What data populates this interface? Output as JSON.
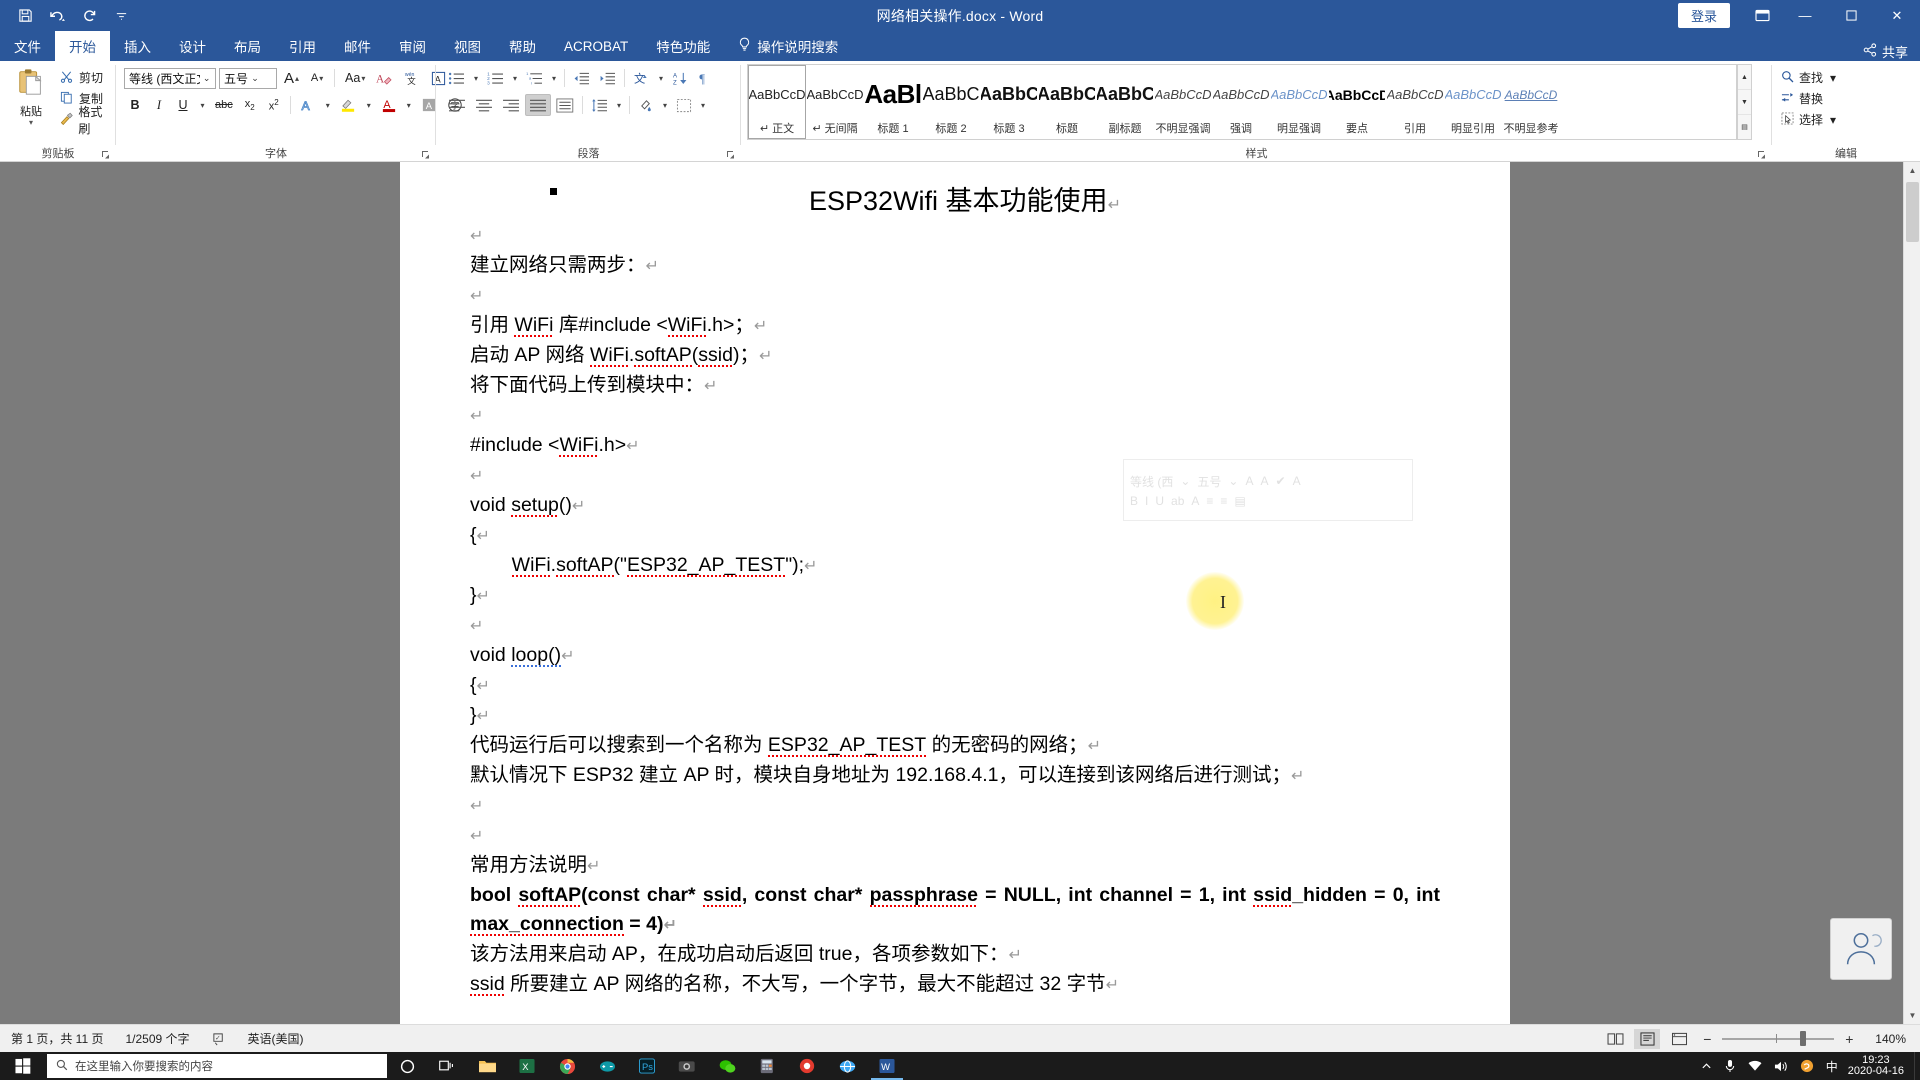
{
  "titlebar": {
    "doc_title": "网络相关操作.docx  -  Word",
    "signin_label": "登录",
    "qat": [
      {
        "name": "save-icon",
        "label": "保存"
      },
      {
        "name": "undo-icon",
        "label": "撤消"
      },
      {
        "name": "redo-icon",
        "label": "恢复"
      },
      {
        "name": "customize-qat-icon",
        "label": "自定义快速访问工具栏"
      }
    ],
    "window_buttons": {
      "minimize": "—",
      "maximize": "☐",
      "close": "✕"
    },
    "ribbon_display_options": "功能区显示选项"
  },
  "tabs": [
    {
      "label": "文件",
      "active": false
    },
    {
      "label": "开始",
      "active": true
    },
    {
      "label": "插入",
      "active": false
    },
    {
      "label": "设计",
      "active": false
    },
    {
      "label": "布局",
      "active": false
    },
    {
      "label": "引用",
      "active": false
    },
    {
      "label": "邮件",
      "active": false
    },
    {
      "label": "审阅",
      "active": false
    },
    {
      "label": "视图",
      "active": false
    },
    {
      "label": "帮助",
      "active": false
    },
    {
      "label": "ACROBAT",
      "active": false
    },
    {
      "label": "特色功能",
      "active": false
    }
  ],
  "tell_me": "操作说明搜索",
  "share_label": "共享",
  "ribbon": {
    "groups": [
      {
        "name": "clipboard",
        "label": "剪贴板"
      },
      {
        "name": "font",
        "label": "字体"
      },
      {
        "name": "paragraph",
        "label": "段落"
      },
      {
        "name": "styles",
        "label": "样式"
      },
      {
        "name": "editing",
        "label": "编辑"
      }
    ],
    "clipboard": {
      "paste_label": "粘贴",
      "items": [
        {
          "label": "剪切",
          "icon": "scissors-icon"
        },
        {
          "label": "复制",
          "icon": "copy-icon"
        },
        {
          "label": "格式刷",
          "icon": "format-painter-icon"
        }
      ]
    },
    "font": {
      "font_name": "等线 (西文正文",
      "font_size": "五号",
      "buttons": [
        {
          "name": "grow-font",
          "label": "A"
        },
        {
          "name": "shrink-font",
          "label": "A"
        },
        {
          "name": "change-case",
          "label": "Aa"
        },
        {
          "name": "clear-formatting",
          "label": "清除所有格式"
        },
        {
          "name": "phonetic-guide",
          "label": "拼音指南"
        },
        {
          "name": "character-border",
          "label": "字符边框"
        },
        {
          "name": "bold",
          "label": "B"
        },
        {
          "name": "italic",
          "label": "I"
        },
        {
          "name": "underline",
          "label": "U"
        },
        {
          "name": "strikethrough",
          "label": "abc"
        },
        {
          "name": "subscript",
          "label": "x₂"
        },
        {
          "name": "superscript",
          "label": "x²"
        },
        {
          "name": "text-effects",
          "label": "A"
        },
        {
          "name": "text-highlight-color",
          "label": "ab"
        },
        {
          "name": "font-color",
          "label": "A"
        },
        {
          "name": "character-shading",
          "label": "A"
        },
        {
          "name": "enclose-characters",
          "label": "字"
        }
      ]
    },
    "paragraph": {
      "buttons": [
        {
          "name": "bullets",
          "label": "项目符号"
        },
        {
          "name": "numbering",
          "label": "编号"
        },
        {
          "name": "multilevel-list",
          "label": "多级列表"
        },
        {
          "name": "decrease-indent",
          "label": "减少缩进量"
        },
        {
          "name": "increase-indent",
          "label": "增加缩进量"
        },
        {
          "name": "asian-layout",
          "label": "中文版式"
        },
        {
          "name": "sort",
          "label": "排序"
        },
        {
          "name": "show-formatting-marks",
          "label": "显示编辑标记"
        },
        {
          "name": "align-left",
          "label": "左对齐"
        },
        {
          "name": "align-center",
          "label": "居中"
        },
        {
          "name": "align-right",
          "label": "右对齐"
        },
        {
          "name": "justify",
          "label": "两端对齐"
        },
        {
          "name": "distributed",
          "label": "分散对齐"
        },
        {
          "name": "line-spacing",
          "label": "行和段落间距"
        },
        {
          "name": "shading",
          "label": "底纹"
        },
        {
          "name": "borders",
          "label": "边框"
        }
      ]
    },
    "styles": {
      "items": [
        {
          "preview": "AaBbCcD",
          "name": "正文",
          "mark": "↵",
          "active": true,
          "style": "normal"
        },
        {
          "preview": "AaBbCcD",
          "name": "无间隔",
          "mark": "↵",
          "active": false,
          "style": "normal"
        },
        {
          "preview": "AaBl",
          "name": "标题 1",
          "mark": "",
          "active": false,
          "style": "h1"
        },
        {
          "preview": "AaBbC",
          "name": "标题 2",
          "mark": "",
          "active": false,
          "style": "h2"
        },
        {
          "preview": "AaBbC",
          "name": "标题 3",
          "mark": "",
          "active": false,
          "style": "h3"
        },
        {
          "preview": "AaBbC",
          "name": "标题",
          "mark": "",
          "active": false,
          "style": "h3"
        },
        {
          "preview": "AaBbC",
          "name": "副标题",
          "mark": "",
          "active": false,
          "style": "h3b"
        },
        {
          "preview": "AaBbCcD",
          "name": "不明显强调",
          "mark": "",
          "active": false,
          "style": "ital"
        },
        {
          "preview": "AaBbCcD",
          "name": "强调",
          "mark": "",
          "active": false,
          "style": "ital"
        },
        {
          "preview": "AaBbCcD",
          "name": "明显强调",
          "mark": "",
          "active": false,
          "style": "italblue"
        },
        {
          "preview": "AaBbCcD",
          "name": "要点",
          "mark": "",
          "active": false,
          "style": "boldn"
        },
        {
          "preview": "AaBbCcD",
          "name": "引用",
          "mark": "",
          "active": false,
          "style": "ital"
        },
        {
          "preview": "AaBbCcD",
          "name": "明显引用",
          "mark": "",
          "active": false,
          "style": "italblue"
        },
        {
          "preview": "AaBbCcD",
          "name": "不明显参考",
          "mark": "",
          "active": false,
          "style": "smallcap"
        }
      ]
    },
    "editing": {
      "items": [
        {
          "label": "查找",
          "icon": "search-icon",
          "caret": true
        },
        {
          "label": "替换",
          "icon": "replace-icon",
          "caret": false
        },
        {
          "label": "选择",
          "icon": "select-icon",
          "caret": true
        }
      ]
    }
  },
  "document": {
    "title": "ESP32Wifi 基本功能使用",
    "paragraphs": [
      {
        "id": "p1",
        "text": "",
        "mark": "↵"
      },
      {
        "id": "p2",
        "text": "建立网络只需两步：",
        "mark": "↵"
      },
      {
        "id": "p3",
        "text": "",
        "mark": "↵"
      },
      {
        "id": "p4",
        "text": "引用 WiFi 库#include <WiFi.h>；",
        "mark": "↵"
      },
      {
        "id": "p5",
        "text": "启动 AP 网络 WiFi.softAP(ssid)；",
        "mark": "↵"
      },
      {
        "id": "p6",
        "text": "将下面代码上传到模块中：",
        "mark": "↵"
      },
      {
        "id": "p7",
        "text": "",
        "mark": "↵"
      },
      {
        "id": "p8",
        "text": "#include <WiFi.h>",
        "mark": "↵"
      },
      {
        "id": "p9",
        "text": "",
        "mark": "↵"
      },
      {
        "id": "p10",
        "text": "void setup()",
        "mark": "↵"
      },
      {
        "id": "p11",
        "text": "{",
        "mark": "↵"
      },
      {
        "id": "p12",
        "text": "    WiFi.softAP(\"ESP32_AP_TEST\");",
        "mark": "↵"
      },
      {
        "id": "p13",
        "text": "}",
        "mark": "↵"
      },
      {
        "id": "p14",
        "text": "",
        "mark": "↵"
      },
      {
        "id": "p15",
        "text": "void loop()",
        "mark": "↵"
      },
      {
        "id": "p16",
        "text": "{",
        "mark": "↵"
      },
      {
        "id": "p17",
        "text": "}",
        "mark": "↵"
      },
      {
        "id": "p18",
        "text": "代码运行后可以搜索到一个名称为 ESP32_AP_TEST 的无密码的网络；",
        "mark": "↵"
      },
      {
        "id": "p19",
        "text": "默认情况下 ESP32 建立 AP 时，模块自身地址为 192.168.4.1，可以连接到该网络后进行测试；",
        "mark": "↵"
      },
      {
        "id": "p20",
        "text": "",
        "mark": "↵"
      },
      {
        "id": "p21",
        "text": "",
        "mark": "↵"
      },
      {
        "id": "p22",
        "text": "常用方法说明",
        "mark": "↵"
      },
      {
        "id": "p23",
        "text": "bool softAP(const char* ssid, const char* passphrase = NULL, int channel = 1, int ssid_hidden = 0, int max_connection = 4)",
        "mark": "↵"
      },
      {
        "id": "p24",
        "text": "该方法用来启动 AP，在成功启动后返回 true，各项参数如下：",
        "mark": "↵"
      },
      {
        "id": "p25",
        "text": "ssid 所要建立 AP 网络的名称，不大写，一个字节，最大不能超过 32 字节",
        "mark": "↵"
      }
    ]
  },
  "statusbar": {
    "page_info": "第 1 页，共 11 页",
    "word_count": "1/2509 个字",
    "proofing_icon": "proofing-errors-icon",
    "language": "英语(美国)",
    "views": [
      {
        "name": "read-mode",
        "label": "阅读视图"
      },
      {
        "name": "print-layout",
        "label": "页面视图",
        "selected": true
      },
      {
        "name": "web-layout",
        "label": "Web 版式视图"
      }
    ],
    "zoom_level": "140%",
    "zoom_out": "−",
    "zoom_in": "+"
  },
  "taskbar": {
    "search_placeholder": "在这里输入你要搜索的内容",
    "start_icon": "windows-start-icon",
    "items": [
      {
        "name": "cortana-icon",
        "label": "Cortana"
      },
      {
        "name": "task-view-icon",
        "label": "任务视图"
      },
      {
        "name": "file-explorer-icon",
        "label": "文件资源管理器"
      },
      {
        "name": "excel-icon",
        "label": "Excel"
      },
      {
        "name": "chrome-icon",
        "label": "Google Chrome"
      },
      {
        "name": "arduino-icon",
        "label": "Arduino"
      },
      {
        "name": "photoshop-icon",
        "label": "Photoshop"
      },
      {
        "name": "camera-icon",
        "label": "相机"
      },
      {
        "name": "wechat-icon",
        "label": "微信"
      },
      {
        "name": "calculator-icon",
        "label": "计算器"
      },
      {
        "name": "recorder-icon",
        "label": "录屏"
      },
      {
        "name": "browser-icon",
        "label": "浏览器"
      },
      {
        "name": "word-icon",
        "label": "Word",
        "active": true
      }
    ],
    "tray": [
      {
        "name": "tray-expand-icon",
        "label": "显示隐藏的图标"
      },
      {
        "name": "microphone-icon",
        "label": "麦克风"
      },
      {
        "name": "network-icon",
        "label": "网络"
      },
      {
        "name": "volume-icon",
        "label": "音量"
      },
      {
        "name": "sogou-icon",
        "label": "搜狗输入法"
      },
      {
        "name": "ime-cn-icon",
        "label": "中"
      }
    ],
    "time": "19:23",
    "date": "2020-04-16"
  }
}
